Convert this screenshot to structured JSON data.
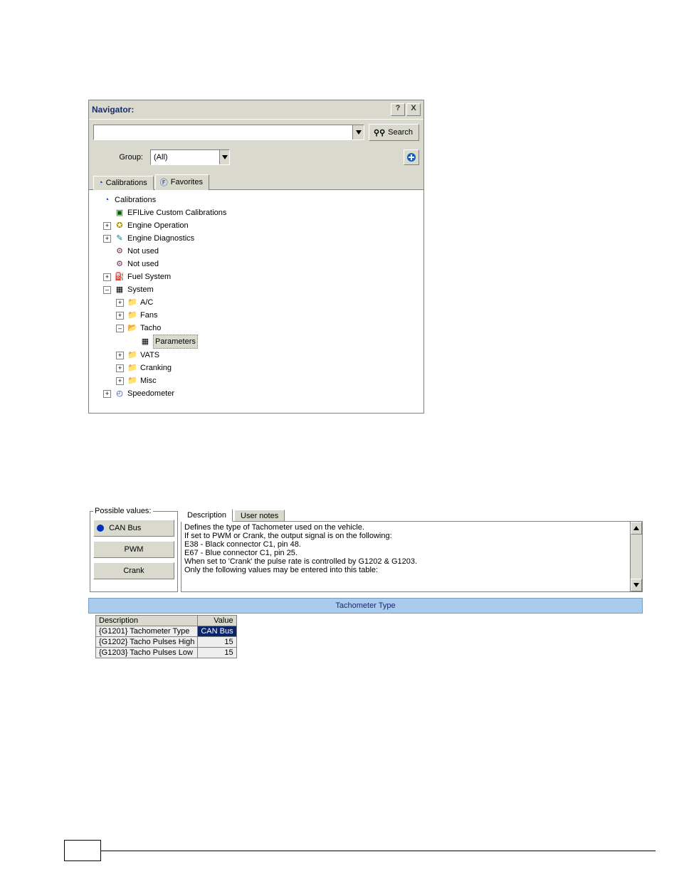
{
  "navigator": {
    "title": "Navigator:",
    "help_btn": "?",
    "close_btn": "X",
    "search_input": "",
    "search_btn": "Search",
    "group_label": "Group:",
    "group_value": "(All)",
    "tabs": {
      "calibrations": "Calibrations",
      "favorites": "Favorites"
    },
    "tree": {
      "root": "Calibrations",
      "efi": "EFILive Custom Calibrations",
      "engine_op": "Engine Operation",
      "engine_diag": "Engine Diagnostics",
      "not_used_1": "Not used",
      "not_used_2": "Not used",
      "fuel": "Fuel System",
      "system": "System",
      "ac": "A/C",
      "fans": "Fans",
      "tacho": "Tacho",
      "parameters": "Parameters",
      "vats": "VATS",
      "cranking": "Cranking",
      "misc": "Misc",
      "speedo": "Speedometer"
    }
  },
  "details": {
    "possible_values_legend": "Possible values:",
    "possible_values": {
      "can": "CAN Bus",
      "pwm": "PWM",
      "crank": "Crank"
    },
    "desc_tabs": {
      "description": "Description",
      "user_notes": "User notes"
    },
    "description_lines": [
      "Defines the type of Tachometer used on the vehicle.",
      "If set to PWM or Crank, the output signal is on the following:",
      "E38 - Black connector C1, pin 48.",
      "E67 - Blue connector C1, pin 25.",
      "When set to 'Crank' the pulse rate is controlled by G1202 & G1203.",
      "",
      "Only the following values may be entered into this table:"
    ],
    "section_header": "Tachometer Type",
    "table": {
      "headers": {
        "desc": "Description",
        "val": "Value"
      },
      "rows": [
        {
          "desc": "{G1201} Tachometer Type",
          "val": "CAN Bus",
          "selected": true
        },
        {
          "desc": "{G1202} Tacho Pulses High",
          "val": "15"
        },
        {
          "desc": "{G1203} Tacho Pulses Low",
          "val": "15"
        }
      ]
    }
  }
}
